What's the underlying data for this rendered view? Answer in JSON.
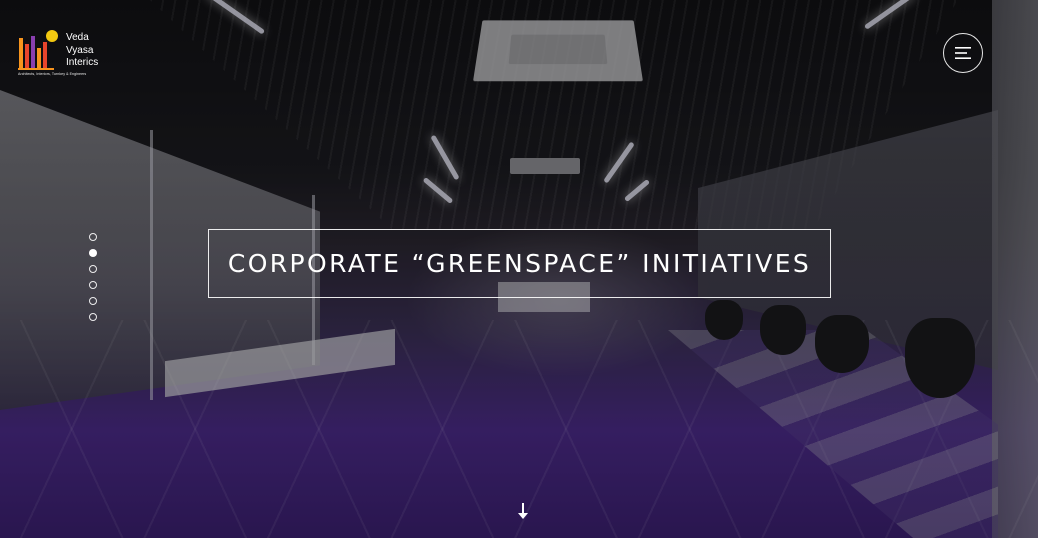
{
  "brand": {
    "name_line1": "Veda",
    "name_line2": "Vyasa",
    "name_line3": "Interics",
    "tagline": "Architects, Interiors, Turnkey & Engineers",
    "logo_colors": [
      "#f2c811",
      "#e8452c",
      "#8a3fb0",
      "#f7941d"
    ]
  },
  "header": {
    "menu_icon": "hamburger-menu-icon"
  },
  "hero": {
    "headline": "CORPORATE “GREENSPACE” INITIATIVES",
    "slide_count": 6,
    "active_slide": 2,
    "scroll_icon": "arrow-down-icon"
  },
  "colors": {
    "text": "#ffffff",
    "floor_accent": "#4a2a86"
  }
}
